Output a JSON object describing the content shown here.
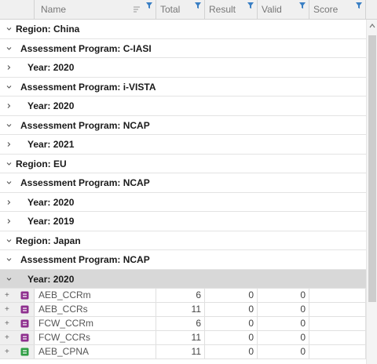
{
  "columns": [
    "Name",
    "Total",
    "Result",
    "Valid",
    "Score"
  ],
  "groups": [
    {
      "label": "Region: China",
      "level": 0,
      "expanded": true
    },
    {
      "label": "Assessment Program: C-IASI",
      "level": 1,
      "expanded": true
    },
    {
      "label": "Year: 2020",
      "level": 2,
      "expanded": false
    },
    {
      "label": "Assessment Program: i-VISTA",
      "level": 1,
      "expanded": true
    },
    {
      "label": "Year: 2020",
      "level": 2,
      "expanded": false
    },
    {
      "label": "Assessment Program: NCAP",
      "level": 1,
      "expanded": true
    },
    {
      "label": "Year: 2021",
      "level": 2,
      "expanded": false
    },
    {
      "label": "Region: EU",
      "level": 0,
      "expanded": true
    },
    {
      "label": "Assessment Program: NCAP",
      "level": 1,
      "expanded": true
    },
    {
      "label": "Year: 2020",
      "level": 2,
      "expanded": false
    },
    {
      "label": "Year: 2019",
      "level": 2,
      "expanded": false
    },
    {
      "label": "Region: Japan",
      "level": 0,
      "expanded": true
    },
    {
      "label": "Assessment Program: NCAP",
      "level": 1,
      "expanded": true
    },
    {
      "label": "Year: 2020",
      "level": 2,
      "expanded": true,
      "selected": true
    }
  ],
  "records": [
    {
      "name": "AEB_CCRm",
      "total": "6",
      "result": "0",
      "valid": "0",
      "score": "",
      "icon_color": "#8e2f8e"
    },
    {
      "name": "AEB_CCRs",
      "total": "11",
      "result": "0",
      "valid": "0",
      "score": "",
      "icon_color": "#8e2f8e"
    },
    {
      "name": "FCW_CCRm",
      "total": "6",
      "result": "0",
      "valid": "0",
      "score": "",
      "icon_color": "#8e2f8e"
    },
    {
      "name": "FCW_CCRs",
      "total": "11",
      "result": "0",
      "valid": "0",
      "score": "",
      "icon_color": "#8e2f8e"
    },
    {
      "name": "AEB_CPNA",
      "total": "11",
      "result": "0",
      "valid": "0",
      "score": "",
      "icon_color": "#2f9e44"
    }
  ]
}
